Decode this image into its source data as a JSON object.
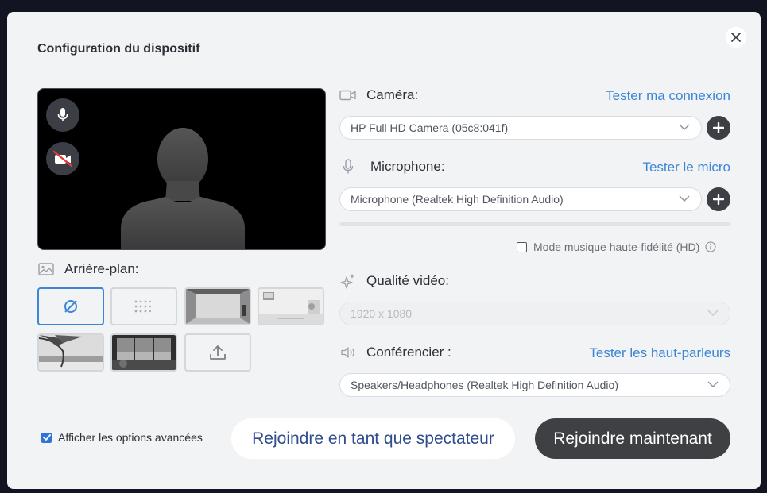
{
  "dialog": {
    "title": "Configuration du dispositif"
  },
  "preview": {
    "mic_button_icon": "microphone-icon",
    "camera_button_icon": "camera-off-icon"
  },
  "camera": {
    "label": "Caméra:",
    "test_link": "Tester ma connexion",
    "selected": "HP Full HD Camera (05c8:041f)"
  },
  "microphone": {
    "label": "Microphone:",
    "test_link": "Tester le micro",
    "selected": "Microphone (Realtek High Definition Audio)",
    "hd_mode_label": "Mode musique haute-fidélité (HD)",
    "hd_mode_checked": false
  },
  "video_quality": {
    "label": "Qualité vidéo:",
    "selected": "1920 x 1080"
  },
  "speaker": {
    "label": "Conférencier :",
    "test_link": "Tester les haut-parleurs",
    "selected": "Speakers/Headphones (Realtek High Definition Audio)"
  },
  "background": {
    "label": "Arrière-plan:",
    "options": [
      "none",
      "blur",
      "room",
      "office",
      "beach",
      "window",
      "upload"
    ],
    "selected": "none"
  },
  "footer": {
    "advanced_label": "Afficher les options avancées",
    "advanced_checked": true,
    "spectator_button": "Rejoindre en tant que spectateur",
    "join_button": "Rejoindre maintenant"
  },
  "colors": {
    "accent": "#3c86d6",
    "primary_button": "#3f4043",
    "dialog_bg": "#f1f3f5"
  }
}
